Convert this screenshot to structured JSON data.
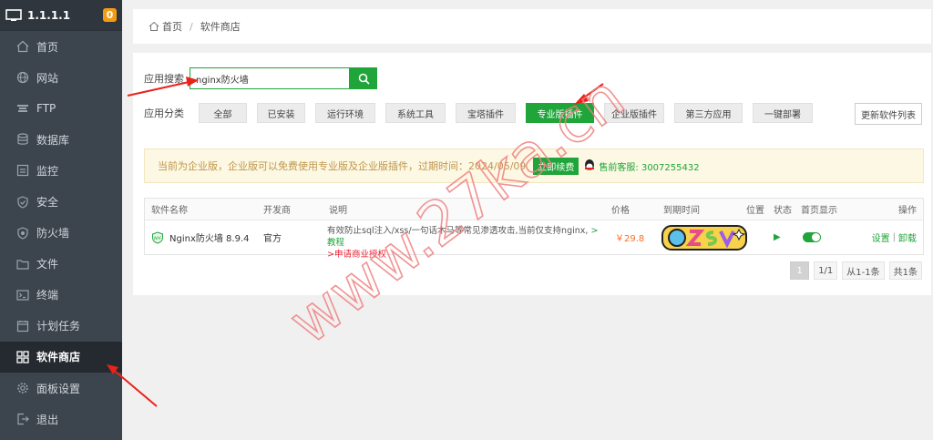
{
  "sidebar": {
    "server_ip": "1.1.1.1",
    "badge_count": "0",
    "items": [
      {
        "label": "首页",
        "icon": "home-icon"
      },
      {
        "label": "网站",
        "icon": "globe-icon"
      },
      {
        "label": "FTP",
        "icon": "ftp-icon"
      },
      {
        "label": "数据库",
        "icon": "database-icon"
      },
      {
        "label": "监控",
        "icon": "monitor-icon"
      },
      {
        "label": "安全",
        "icon": "shield-icon"
      },
      {
        "label": "防火墙",
        "icon": "firewall-icon"
      },
      {
        "label": "文件",
        "icon": "folder-icon"
      },
      {
        "label": "终端",
        "icon": "terminal-icon"
      },
      {
        "label": "计划任务",
        "icon": "clock-icon"
      },
      {
        "label": "软件商店",
        "icon": "grid-icon",
        "active": true
      },
      {
        "label": "面板设置",
        "icon": "gear-icon"
      },
      {
        "label": "退出",
        "icon": "logout-icon"
      }
    ]
  },
  "breadcrumb": {
    "home": "首页",
    "sep": "/",
    "current": "软件商店"
  },
  "search": {
    "label": "应用搜索",
    "value": "nginx防火墙"
  },
  "category": {
    "label": "应用分类",
    "buttons": [
      "全部",
      "已安装",
      "运行环境",
      "系统工具",
      "宝塔插件",
      "专业版插件",
      "企业版插件",
      "第三方应用",
      "一键部署"
    ],
    "active_index": 5,
    "update_label": "更新软件列表"
  },
  "notice": {
    "text": "当前为企业版，企业版可以免费使用专业版及企业版插件，过期时间：2024/05/09",
    "buy_label": "立即续费",
    "service_label": "售前客服: 3007255432"
  },
  "table": {
    "headers": {
      "name": "软件名称",
      "dev": "开发商",
      "desc": "说明",
      "price": "价格",
      "expire": "到期时间",
      "position": "位置",
      "status": "状态",
      "home": "首页显示",
      "ops": "操作"
    },
    "rows": [
      {
        "name": "Nginx防火墙 8.9.4",
        "dev": "官方",
        "desc": "有效防止sql注入/xss/一句话木马等常见渗透攻击,当前仅支持nginx,",
        "tutorial": ">教程",
        "apply": ">申请商业授权",
        "price": "￥29.8",
        "settings": "设置",
        "uninstall": "卸载"
      }
    ]
  },
  "pager": {
    "current": "1",
    "pages": "1/1",
    "range": "从1-1条",
    "total": "共1条"
  },
  "watermark": "www.27ka.cn",
  "colors": {
    "accent": "#20a53a",
    "sidebar": "#3c444d",
    "annotation": "#e8231b"
  }
}
